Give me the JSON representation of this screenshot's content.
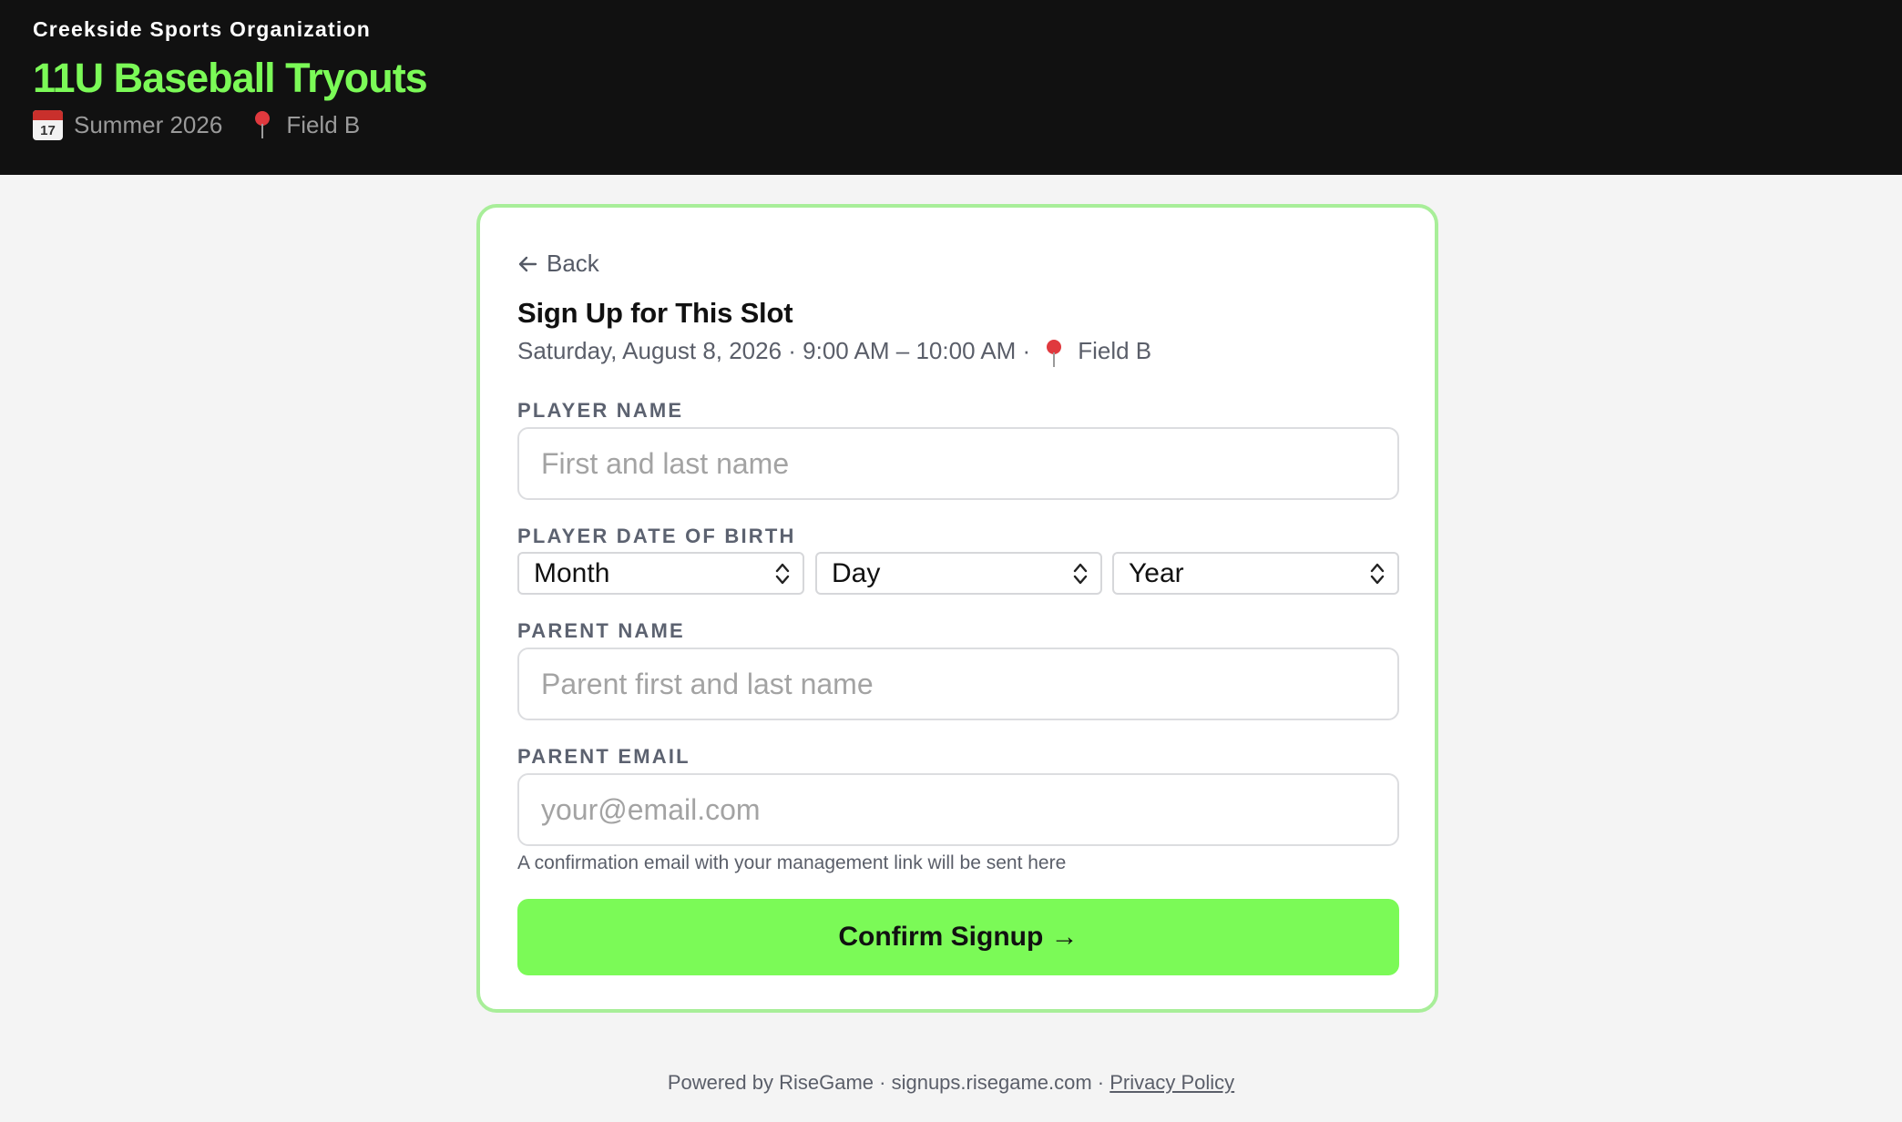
{
  "header": {
    "org_name": "Creekside Sports Organization",
    "event_title": "11U Baseball Tryouts",
    "season": "Summer 2026",
    "location": "Field B",
    "calendar_icon_day": "17",
    "title_color": "#7bfa57",
    "background_color": "#111111"
  },
  "card": {
    "back_label": "Back",
    "title": "Sign Up for This Slot",
    "slot_details": "Saturday, August 8, 2026 · 9:00 AM – 10:00 AM ·",
    "slot_location": "Field B",
    "border_color": "#a8ee99"
  },
  "form": {
    "player_name_label": "PLAYER NAME",
    "player_name_placeholder": "First and last name",
    "player_name_value": "",
    "dob_label": "PLAYER DATE OF BIRTH",
    "dob_month": "Month",
    "dob_day": "Day",
    "dob_year": "Year",
    "parent_name_label": "PARENT NAME",
    "parent_name_placeholder": "Parent first and last name",
    "parent_name_value": "",
    "parent_email_label": "PARENT EMAIL",
    "parent_email_placeholder": "your@email.com",
    "parent_email_value": "",
    "helper_text": "A confirmation email with your management link will be sent here",
    "submit_label": "Confirm Signup →",
    "submit_color": "#7bfa57"
  },
  "footer": {
    "powered_by": "Powered by RiseGame · signups.risegame.com ·",
    "privacy_link": "Privacy Policy"
  }
}
